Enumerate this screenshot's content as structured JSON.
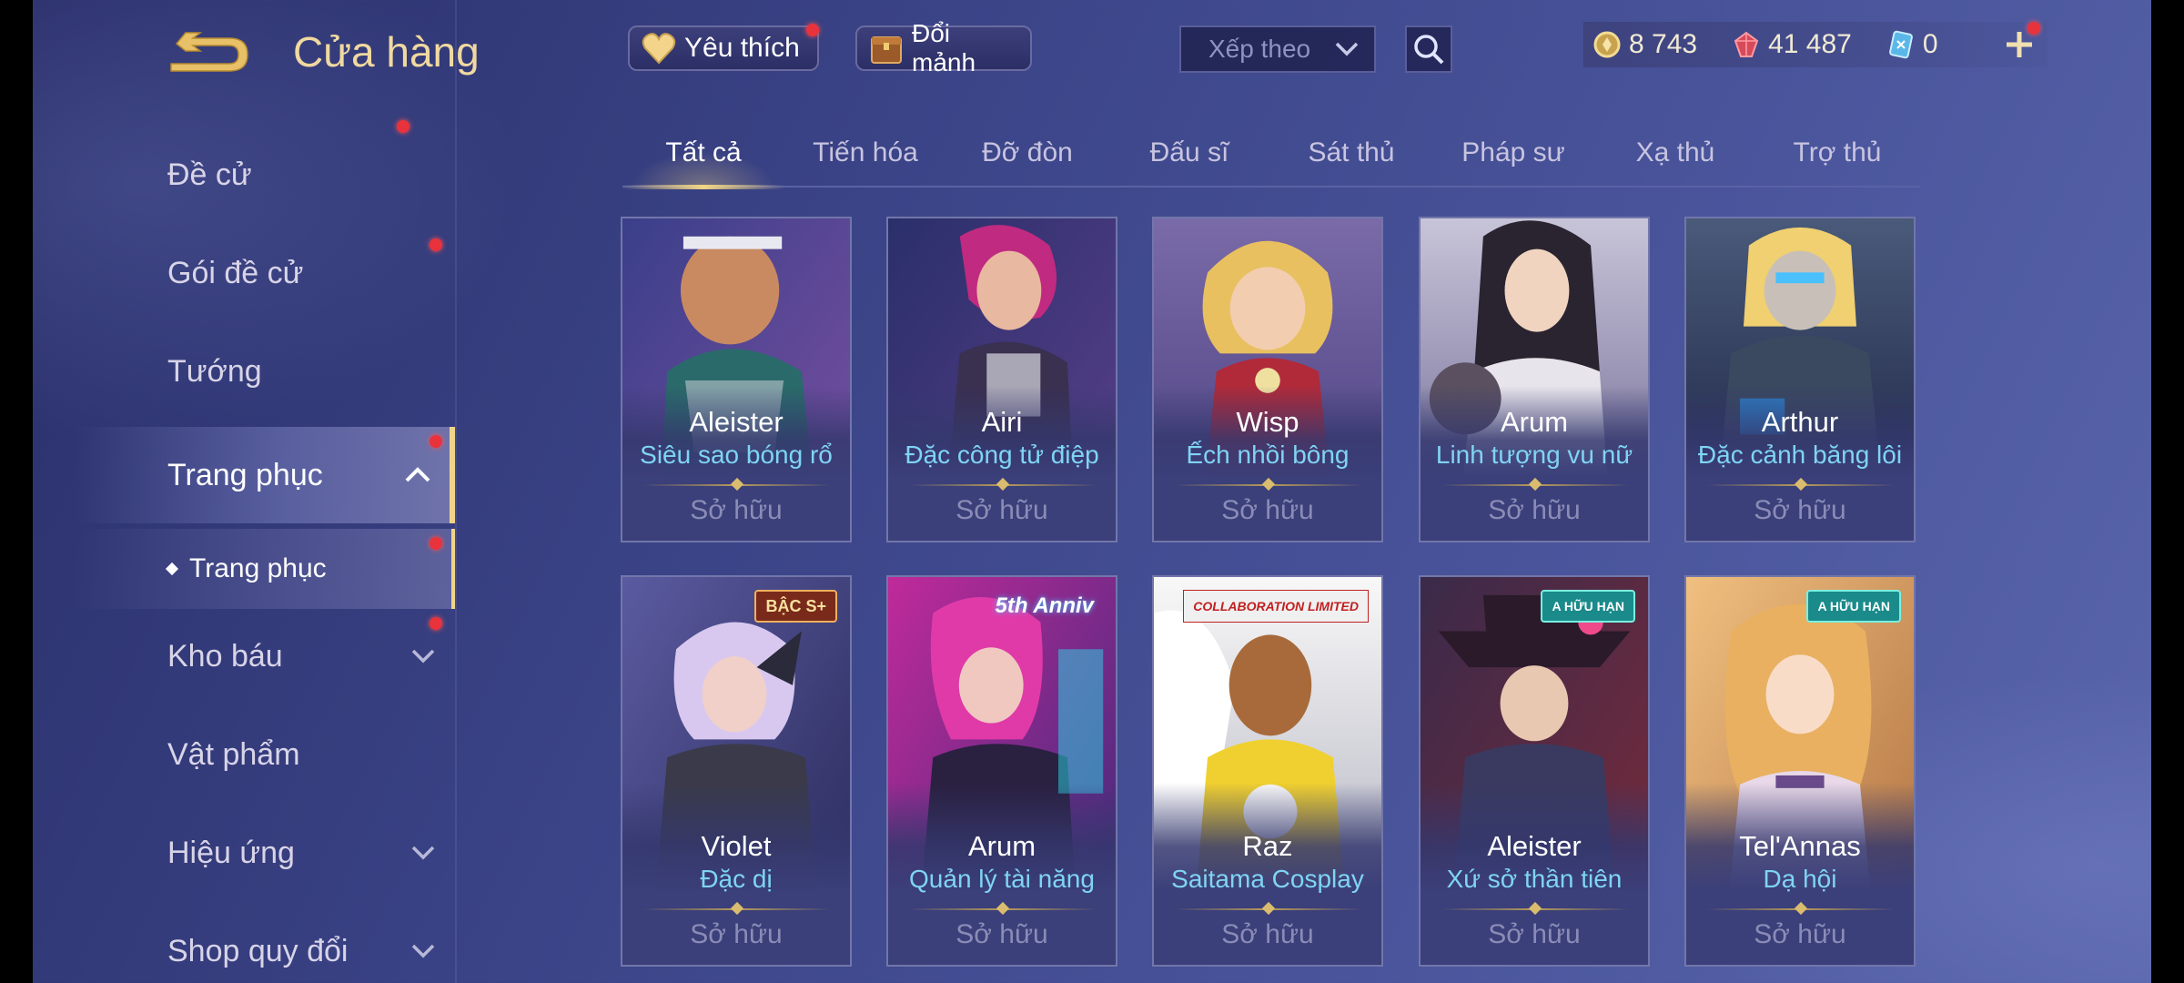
{
  "header": {
    "title": "Cửa hàng",
    "favorites_label": "Yêu thích",
    "shards_label": "Đổi mảnh",
    "sort_placeholder": "Xếp theo",
    "currencies": [
      {
        "icon": "gold-coin-icon",
        "value": "8 743"
      },
      {
        "icon": "red-gem-icon",
        "value": "41 487"
      },
      {
        "icon": "blue-voucher-icon",
        "value": "0"
      }
    ]
  },
  "sidebar": {
    "items": [
      {
        "label": "Đề cử"
      },
      {
        "label": "Gói đề cử"
      },
      {
        "label": "Tướng"
      },
      {
        "label": "Trang phục"
      },
      {
        "label": "Trang phục"
      },
      {
        "label": "Kho báu"
      },
      {
        "label": "Vật phẩm"
      },
      {
        "label": "Hiệu ứng"
      },
      {
        "label": "Shop quy đổi"
      }
    ]
  },
  "tabs": [
    "Tất cả",
    "Tiến hóa",
    "Đỡ đòn",
    "Đấu sĩ",
    "Sát thủ",
    "Pháp sư",
    "Xạ thủ",
    "Trợ thủ"
  ],
  "cards": [
    {
      "hero": "Aleister",
      "skin": "Siêu sao bóng rổ",
      "status": "Sở hữu",
      "badge": ""
    },
    {
      "hero": "Airi",
      "skin": "Đặc công tử điệp",
      "status": "Sở hữu",
      "badge": ""
    },
    {
      "hero": "Wisp",
      "skin": "Ếch nhồi bông",
      "status": "Sở hữu",
      "badge": ""
    },
    {
      "hero": "Arum",
      "skin": "Linh tượng vu nữ",
      "status": "Sở hữu",
      "badge": ""
    },
    {
      "hero": "Arthur",
      "skin": "Đặc cảnh băng lôi",
      "status": "Sở hữu",
      "badge": ""
    },
    {
      "hero": "Violet",
      "skin": "Đặc dị",
      "status": "Sở hữu",
      "badge": "BẬC S+"
    },
    {
      "hero": "Arum",
      "skin": "Quản lý tài năng",
      "status": "Sở hữu",
      "badge": "5th Anniv"
    },
    {
      "hero": "Raz",
      "skin": "Saitama Cosplay",
      "status": "Sở hữu",
      "badge": "COLLABORATION LIMITED"
    },
    {
      "hero": "Aleister",
      "skin": "Xứ sở thần tiên",
      "status": "Sở hữu",
      "badge": "A HỮU HẠN"
    },
    {
      "hero": "Tel'Annas",
      "skin": "Dạ hội",
      "status": "Sở hữu",
      "badge": "A HỮU HẠN"
    }
  ],
  "colors": {
    "accent_gold": "#f0d48a",
    "skin_name_blue": "#7fd4f4",
    "notification_red": "#e8323c"
  }
}
